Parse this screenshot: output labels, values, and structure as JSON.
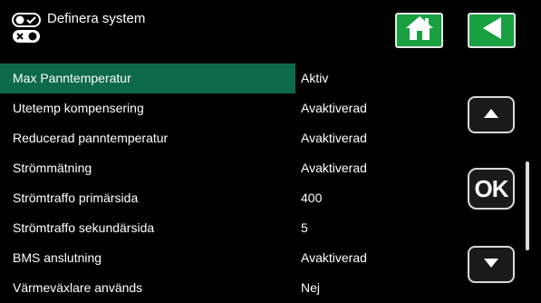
{
  "header": {
    "title": "Definera system",
    "icons": {
      "system": "toggle-switches-icon",
      "home": "home-icon",
      "back": "back-arrow-icon"
    }
  },
  "settings": [
    {
      "label": "Max Panntemperatur",
      "value": "Aktiv",
      "selected": true
    },
    {
      "label": "Utetemp kompensering",
      "value": "Avaktiverad"
    },
    {
      "label": "Reducerad panntemperatur",
      "value": "Avaktiverad"
    },
    {
      "label": "Strömmätning",
      "value": "Avaktiverad"
    },
    {
      "label": "Strömtraffo primärsida",
      "value": "400"
    },
    {
      "label": "Strömtraffo sekundärsida",
      "value": "5"
    },
    {
      "label": "BMS anslutning",
      "value": "Avaktiverad"
    },
    {
      "label": "Värmeväxlare används",
      "value": "Nej"
    }
  ],
  "controls": {
    "up_icon": "arrow-up-icon",
    "ok_label": "OK",
    "down_icon": "arrow-down-icon"
  },
  "colors": {
    "accent_green": "#18a041",
    "selected_row": "#0d6a48",
    "background": "#000000"
  }
}
